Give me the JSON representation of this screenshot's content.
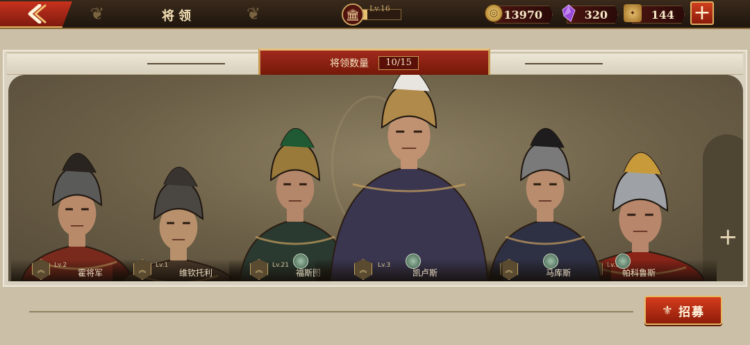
{
  "header": {
    "title": "将领",
    "level_text": "Lv.16",
    "level_progress": 0.15
  },
  "resources": {
    "coins": "13970",
    "gems": "320",
    "tickets": "144"
  },
  "panel": {
    "count_label": "将领数量",
    "count_value": "10/15"
  },
  "heroes": [
    {
      "name": "霍将军",
      "level": "Lv.2",
      "helmet": "#5a5a58",
      "armor": "#7a2a1c",
      "skin": "#b88a6a",
      "crest": "#2a2420"
    },
    {
      "name": "维钦托利",
      "level": "Lv.1",
      "helmet": "#4a4642",
      "armor": "#4a3a2a",
      "skin": "#b8906c",
      "crest": "#3a3430"
    },
    {
      "name": "福斯图",
      "level": "Lv.21",
      "helmet": "#9a7a3a",
      "armor": "#2a3a30",
      "skin": "#b4866a",
      "crest": "#1f5a34"
    },
    {
      "name": "凯卢斯",
      "level": "Lv.3",
      "helmet": "#b08a4a",
      "armor": "#3a3650",
      "skin": "#c09272",
      "crest": "#e8e4e0"
    },
    {
      "name": "马库斯",
      "level": "",
      "helmet": "#7a7a7a",
      "armor": "#2e3044",
      "skin": "#b88c6c",
      "crest": "#1e1c1c"
    },
    {
      "name": "帕科鲁斯",
      "level": "Lv.30",
      "helmet": "#9ea2a6",
      "armor": "#8a2418",
      "skin": "#b8866a",
      "crest": "#c89a3a"
    }
  ],
  "recruit": {
    "label": "招募"
  },
  "icons": {
    "back": "back-arrow-icon",
    "level": "temple-icon",
    "coin": "gold-coin-icon",
    "gem": "purple-gem-icon",
    "ticket": "recruit-ticket-icon",
    "add": "plus-icon"
  }
}
